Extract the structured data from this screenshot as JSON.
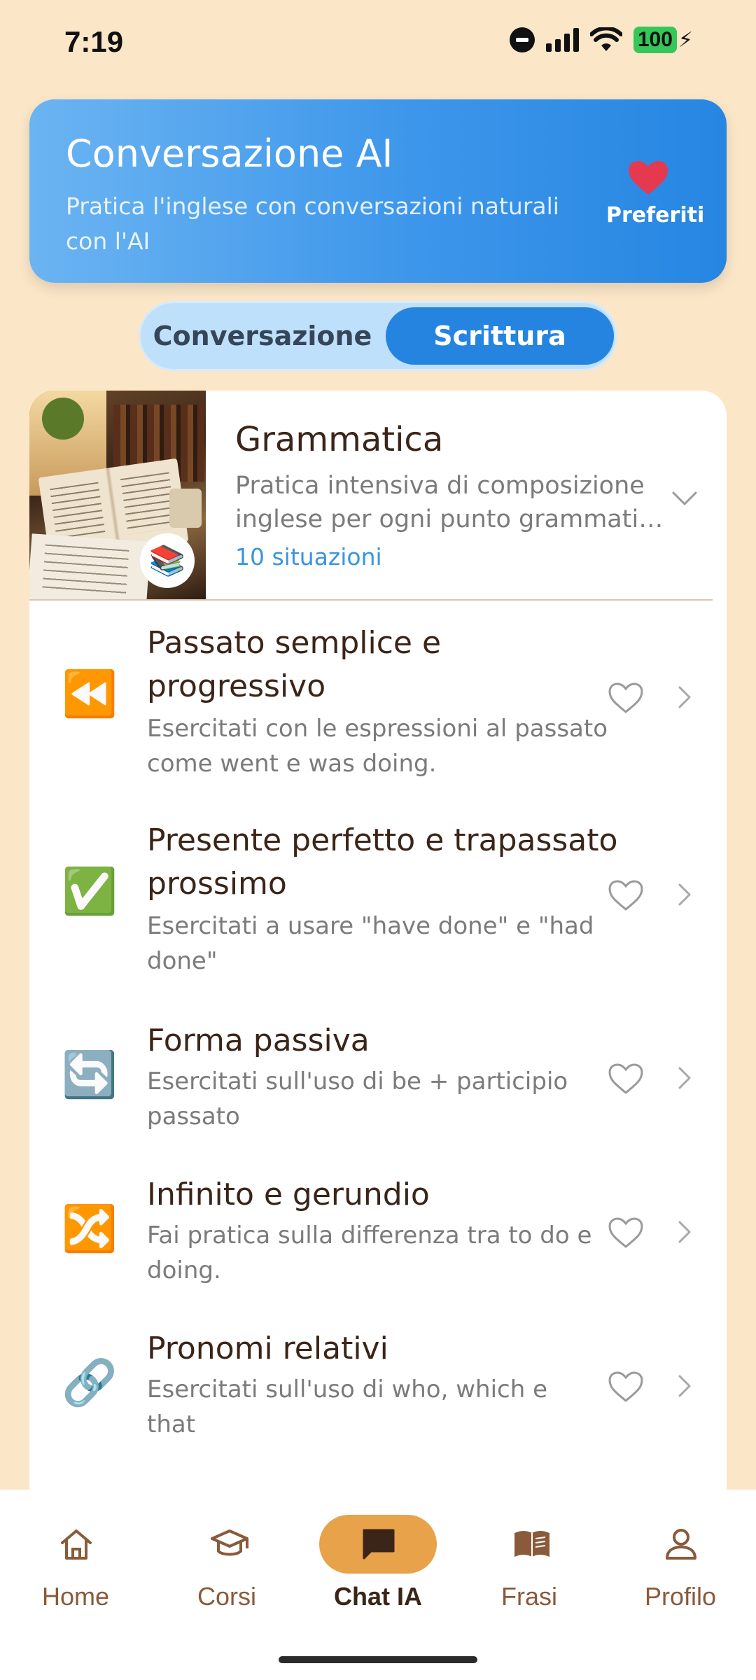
{
  "status_bar": {
    "time": "7:19",
    "battery": "100"
  },
  "header": {
    "title": "Conversazione AI",
    "subtitle": "Pratica l'inglese con conversazioni naturali con l'AI",
    "favorites_label": "Preferiti",
    "accent_color": "#2686e2"
  },
  "toggle": {
    "options": [
      "Conversazione",
      "Scrittura"
    ],
    "selected": "Scrittura"
  },
  "category": {
    "title": "Grammatica",
    "description_line1": "Pratica intensiva di composizione",
    "description_line2": "inglese per ogni punto grammaticale",
    "count": "10 situazioni",
    "badge_icon": "books-icon",
    "expanded": true
  },
  "items": [
    {
      "icon": "⏪",
      "icon_name": "rewind-icon",
      "title": "Passato semplice e progressivo",
      "description": "Esercitati con le espressioni al passato come went e was doing."
    },
    {
      "icon": "✅",
      "icon_name": "check-icon",
      "title": "Presente perfetto e trapassato prossimo",
      "description": "Esercitati a usare \"have done\" e \"had done\""
    },
    {
      "icon": "🔄",
      "icon_name": "cycle-arrows-icon",
      "title": "Forma passiva",
      "description": "Esercitati sull'uso di be + participio passato"
    },
    {
      "icon": "🔀",
      "icon_name": "shuffle-icon",
      "title": "Infinito e gerundio",
      "description": "Fai pratica sulla differenza tra to do e doing."
    },
    {
      "icon": "🔗",
      "icon_name": "link-icon",
      "title": "Pronomi relativi",
      "description": "Esercitati sull'uso di who, which e that"
    }
  ],
  "nav": {
    "items": [
      {
        "label": "Home",
        "icon": "home-icon"
      },
      {
        "label": "Corsi",
        "icon": "graduation-cap-icon"
      },
      {
        "label": "Chat IA",
        "icon": "chat-bubble-icon"
      },
      {
        "label": "Frasi",
        "icon": "open-book-icon"
      },
      {
        "label": "Profilo",
        "icon": "person-icon"
      }
    ],
    "active": "Chat IA"
  }
}
